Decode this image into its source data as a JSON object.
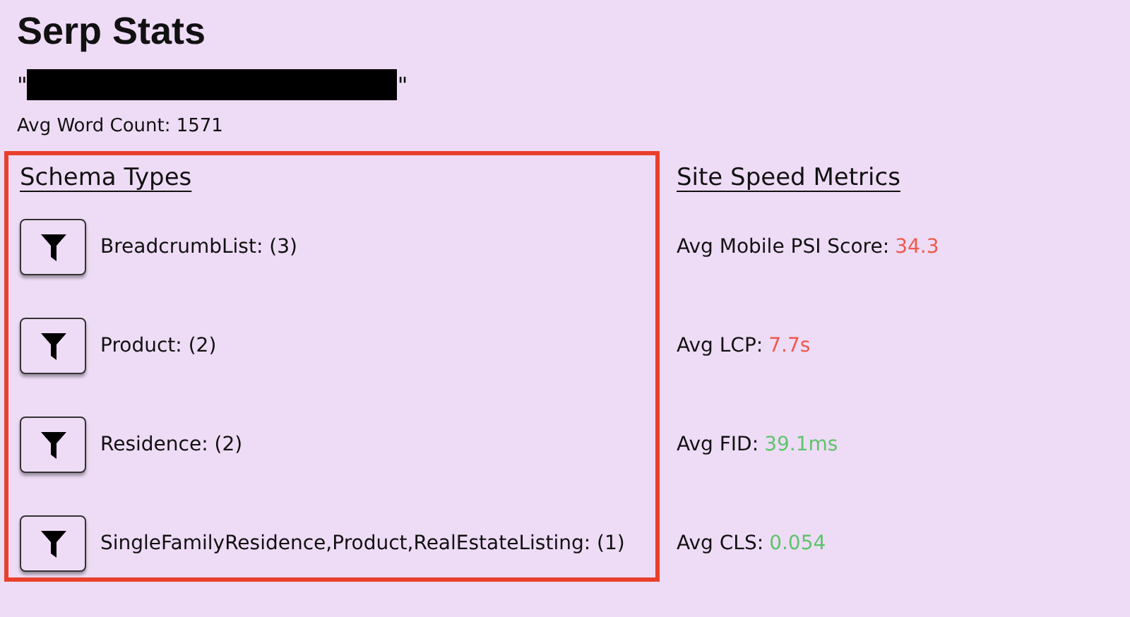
{
  "title": "Serp Stats",
  "query": {
    "open_quote": "\"",
    "close_quote": "\"",
    "redacted": true
  },
  "avg_word_count": "Avg Word Count: 1571",
  "schema_types": {
    "heading": "Schema Types",
    "items": [
      {
        "label": "BreadcrumbList: (3)"
      },
      {
        "label": "Product: (2)"
      },
      {
        "label": "Residence: (2)"
      },
      {
        "label": "SingleFamilyResidence,Product,RealEstateListing: (1)"
      }
    ]
  },
  "site_speed": {
    "heading": "Site Speed Metrics",
    "metrics": [
      {
        "label": "Avg Mobile PSI Score:",
        "value": "34.3",
        "color": "#ee5a4f"
      },
      {
        "label": "Avg LCP:",
        "value": "7.7s",
        "color": "#ee5a4f"
      },
      {
        "label": "Avg FID:",
        "value": "39.1ms",
        "color": "#5ec46b"
      },
      {
        "label": "Avg CLS:",
        "value": "0.054",
        "color": "#5ec46b"
      }
    ]
  }
}
